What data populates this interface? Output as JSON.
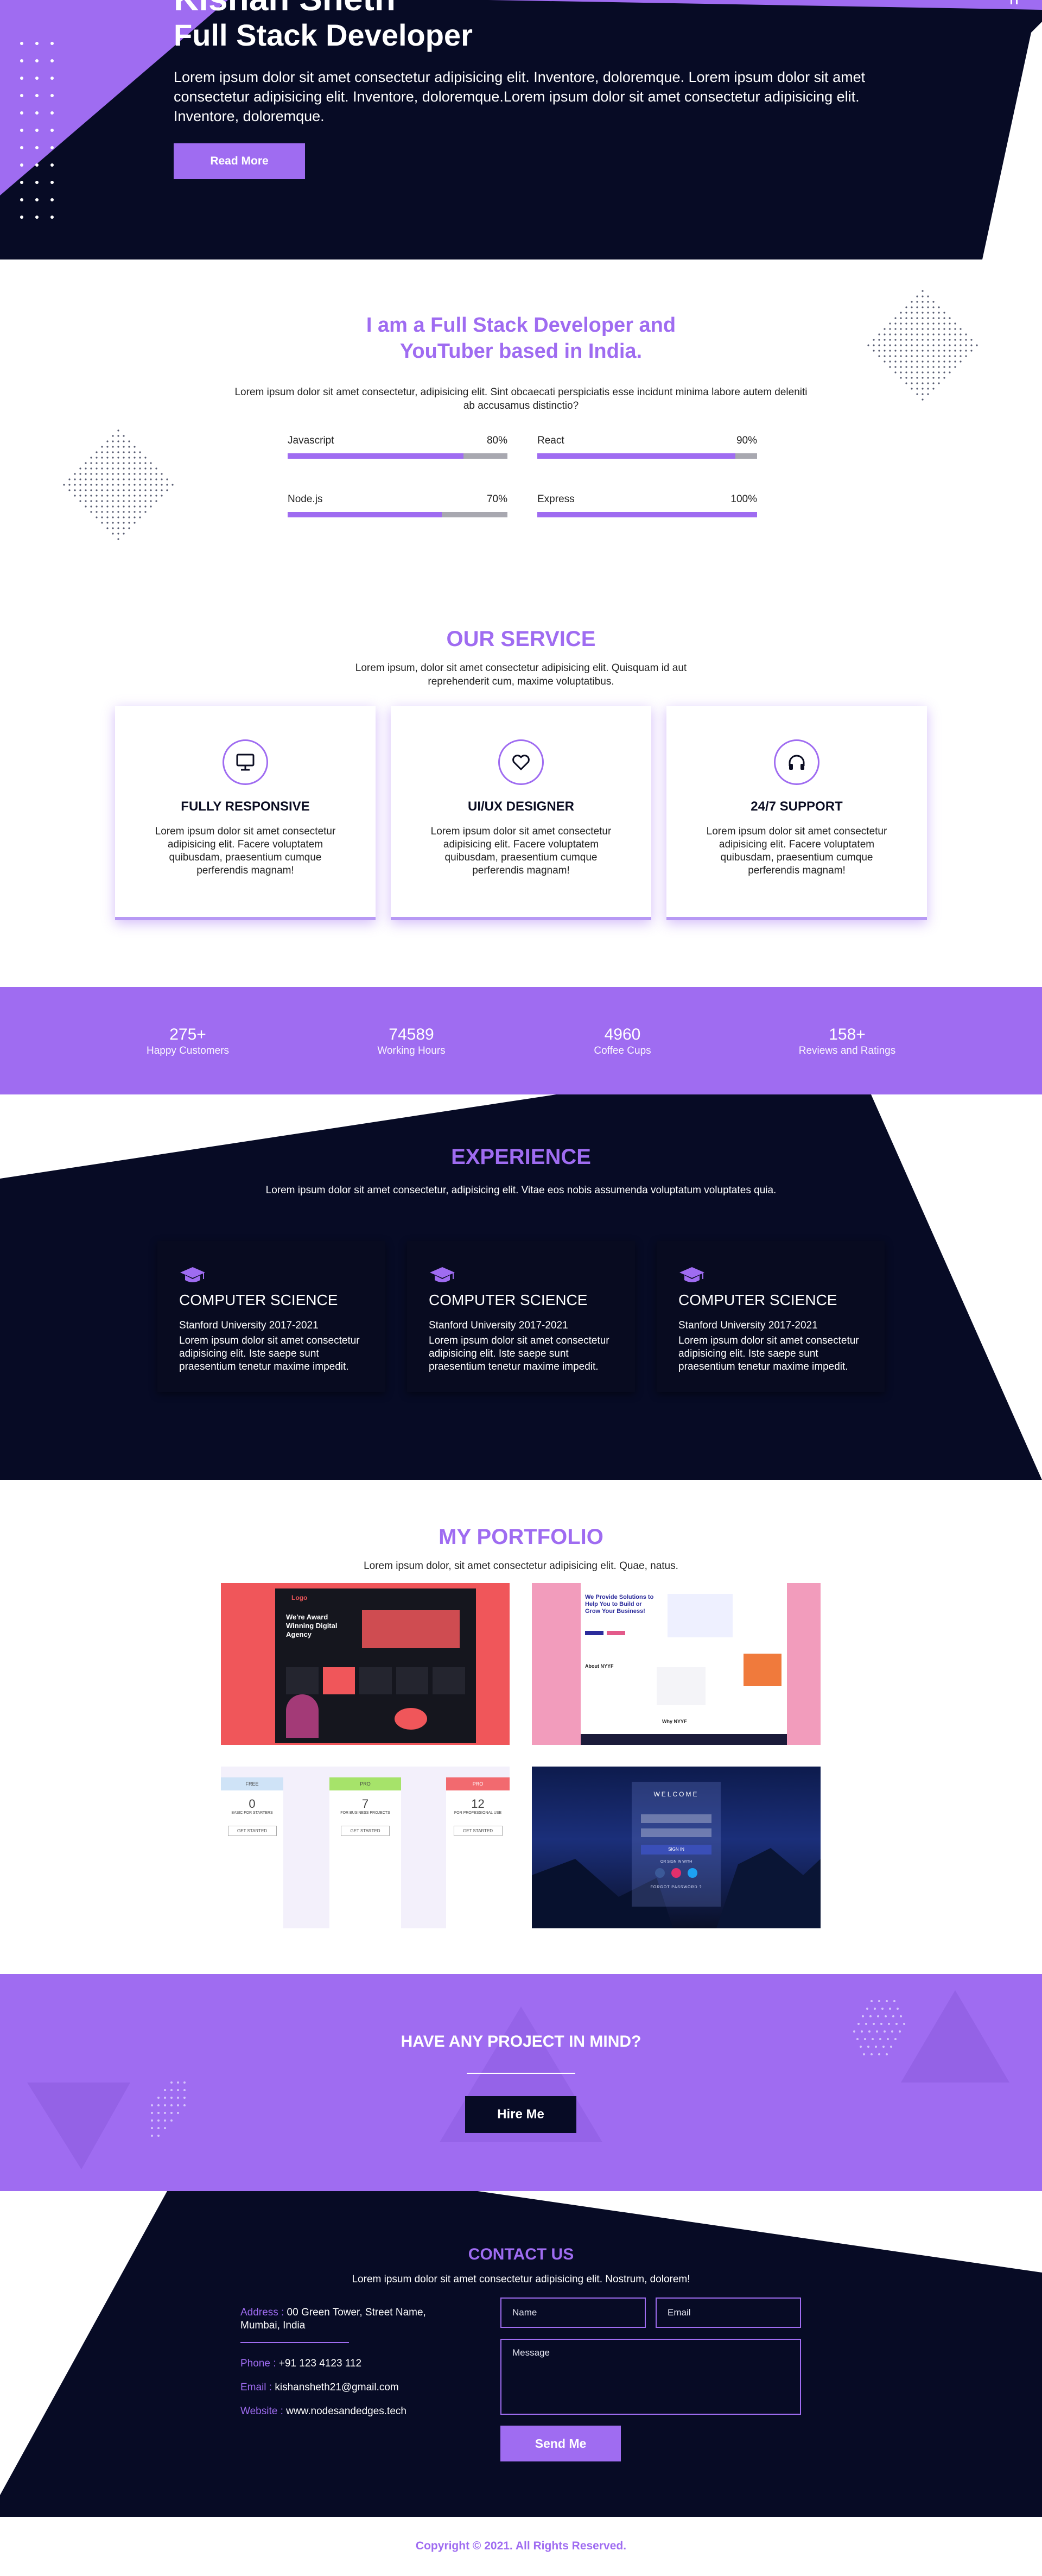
{
  "colors": {
    "accent": "#9f6cf1",
    "navy": "#070b25",
    "white": "#ffffff"
  },
  "hero": {
    "title_cut": "Kishan Sheth",
    "subtitle": "Full Stack Developer",
    "text": "Lorem ipsum dolor sit amet consectetur adipisicing elit. Inventore, doloremque. Lorem ipsum dolor sit amet consectetur adipisicing elit. Inventore, doloremque.Lorem ipsum dolor sit amet consectetur adipisicing elit. Inventore, doloremque.",
    "button": "Read More"
  },
  "about": {
    "title_line1": "I am a Full Stack Developer and",
    "title_line2": "YouTuber based in India.",
    "text": "Lorem ipsum dolor sit amet consectetur, adipisicing elit. Sint obcaecati perspiciatis esse incidunt minima labore autem deleniti ab accusamus distinctio?",
    "skills": [
      {
        "name": "Javascript",
        "percent": "80%",
        "value": 0.8
      },
      {
        "name": "React",
        "percent": "90%",
        "value": 0.9
      },
      {
        "name": "Node.js",
        "percent": "70%",
        "value": 0.7
      },
      {
        "name": "Express",
        "percent": "100%",
        "value": 1.0
      }
    ]
  },
  "service": {
    "title": "OUR SERVICE",
    "subtitle": "Lorem ipsum, dolor sit amet consectetur adipisicing elit. Quisquam id aut reprehenderit cum, maxime voluptatibus.",
    "cards": [
      {
        "icon": "monitor-icon",
        "title": "FULLY RESPONSIVE",
        "text": "Lorem ipsum dolor sit amet consectetur adipisicing elit. Facere voluptatem quibusdam, praesentium cumque perferendis magnam!"
      },
      {
        "icon": "heart-icon",
        "title": "UI/UX DESIGNER",
        "text": "Lorem ipsum dolor sit amet consectetur adipisicing elit. Facere voluptatem quibusdam, praesentium cumque perferendis magnam!"
      },
      {
        "icon": "headphones-icon",
        "title": "24/7 SUPPORT",
        "text": "Lorem ipsum dolor sit amet consectetur adipisicing elit. Facere voluptatem quibusdam, praesentium cumque perferendis magnam!"
      }
    ]
  },
  "stats": [
    {
      "num": "275+",
      "label": "Happy Customers"
    },
    {
      "num": "74589",
      "label": "Working Hours"
    },
    {
      "num": "4960",
      "label": "Coffee Cups"
    },
    {
      "num": "158+",
      "label": "Reviews and Ratings"
    }
  ],
  "experience": {
    "title": "EXPERIENCE",
    "subtitle": "Lorem ipsum dolor sit amet consectetur, adipisicing elit. Vitae eos nobis assumenda voluptatum voluptates quia.",
    "cards": [
      {
        "icon": "graduation-cap-icon",
        "title": "COMPUTER SCIENCE",
        "meta": "Stanford University 2017-2021",
        "text": "Lorem ipsum dolor sit amet consectetur adipisicing elit. Iste saepe sunt praesentium tenetur maxime impedit."
      },
      {
        "icon": "graduation-cap-icon",
        "title": "COMPUTER SCIENCE",
        "meta": "Stanford University 2017-2021",
        "text": "Lorem ipsum dolor sit amet consectetur adipisicing elit. Iste saepe sunt praesentium tenetur maxime impedit."
      },
      {
        "icon": "graduation-cap-icon",
        "title": "COMPUTER SCIENCE",
        "meta": "Stanford University 2017-2021",
        "text": "Lorem ipsum dolor sit amet consectetur adipisicing elit. Iste saepe sunt praesentium tenetur maxime impedit."
      }
    ]
  },
  "portfolio": {
    "title": "MY PORTFOLIO",
    "subtitle": "Lorem ipsum dolor, sit amet consectetur adipisicing elit. Quae, natus.",
    "shot1": {
      "headline": "We're Award Winning Digital Agency",
      "brand": "Logo"
    },
    "shot2": {
      "headline": "We Provide Solutions to Help You to Build or Grow Your Business!",
      "about": "About NYYF",
      "why": "Why NYYF"
    },
    "shot3": {
      "plans": [
        {
          "name": "FREE",
          "price": "0",
          "sub": "BASIC FOR STARTERS",
          "btn": "GET STARTED",
          "color": "#cfe3f7"
        },
        {
          "name": "PRO",
          "price": "7",
          "sub": "FOR BUSINESS PROJECTS",
          "btn": "GET STARTED",
          "color": "#a6e36a"
        },
        {
          "name": "PRO",
          "price": "12",
          "sub": "FOR PROFESSIONAL USE",
          "btn": "GET STARTED",
          "color": "#f26a6f"
        }
      ]
    },
    "shot4": {
      "welcome": "WELCOME",
      "signin": "SIGN IN",
      "or": "OR SIGN IN WITH",
      "forgot": "FORGOT PASSWORD ?"
    }
  },
  "project": {
    "title": "HAVE ANY PROJECT IN MIND?",
    "button": "Hire Me"
  },
  "contact": {
    "title": "CONTACT US",
    "subtitle": "Lorem ipsum dolor sit amet consectetur adipisicing elit. Nostrum, dolorem!",
    "address_label": "Address :",
    "address": "00 Green Tower, Street Name, Mumbai, India",
    "phone_label": "Phone :",
    "phone": "+91 123 4123 112",
    "email_label": "Email :",
    "email": "kishansheth21@gmail.com",
    "website_label": "Website :",
    "website": "www.nodesandedges.tech",
    "name_placeholder": "Name",
    "email_placeholder": "Email",
    "message_placeholder": "Message",
    "send": "Send Me"
  },
  "footer": {
    "text": "Copyright © 2021. All Rights Reserved."
  }
}
